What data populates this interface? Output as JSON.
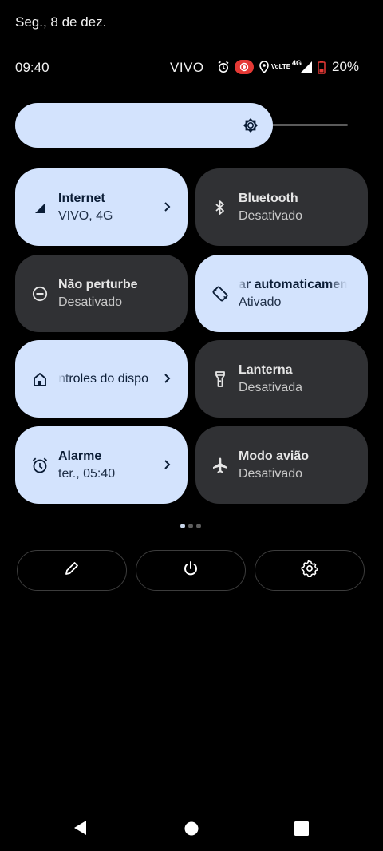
{
  "status_bar": {
    "date": "Seg., 8 de dez.",
    "time": "09:40",
    "carrier": "VIVO",
    "volte_top": "Vo",
    "volte_bottom": "LTE",
    "network": "4G",
    "battery": "20%",
    "icons": [
      "alarm-icon",
      "screen-record-icon",
      "location-icon",
      "volte-icon",
      "signal-icon",
      "battery-icon"
    ]
  },
  "brightness": {
    "level": 0.7,
    "icon": "brightness-icon"
  },
  "tiles": [
    {
      "title": "Internet",
      "subtitle": "VIVO, 4G",
      "state": "on",
      "icon": "signal-icon",
      "chevron": true
    },
    {
      "title": "Bluetooth",
      "subtitle": "Desativado",
      "state": "off",
      "icon": "bluetooth-icon",
      "chevron": false
    },
    {
      "title": "Não perturbe",
      "subtitle": "Desativado",
      "state": "off",
      "icon": "do-not-disturb-icon",
      "chevron": false
    },
    {
      "title": "ar automaticamen",
      "subtitle": "Ativado",
      "state": "on",
      "icon": "auto-rotate-icon",
      "chevron": false
    },
    {
      "title": "ntroles do dispo",
      "subtitle": "",
      "state": "on",
      "icon": "home-icon",
      "chevron": true
    },
    {
      "title": "Lanterna",
      "subtitle": "Desativada",
      "state": "off",
      "icon": "flashlight-icon",
      "chevron": false
    },
    {
      "title": "Alarme",
      "subtitle": "ter., 05:40",
      "state": "on",
      "icon": "alarm-icon",
      "chevron": true
    },
    {
      "title": "Modo avião",
      "subtitle": "Desativado",
      "state": "off",
      "icon": "airplane-icon",
      "chevron": false
    }
  ],
  "pages": {
    "count": 3,
    "active": 1
  },
  "actions": [
    "edit-icon",
    "power-icon",
    "settings-icon"
  ],
  "nav_bar": [
    "back-icon",
    "home-icon",
    "recents-icon"
  ],
  "colors": {
    "tile_on": "#d3e3fd",
    "tile_off": "#303134",
    "background": "#000000"
  }
}
